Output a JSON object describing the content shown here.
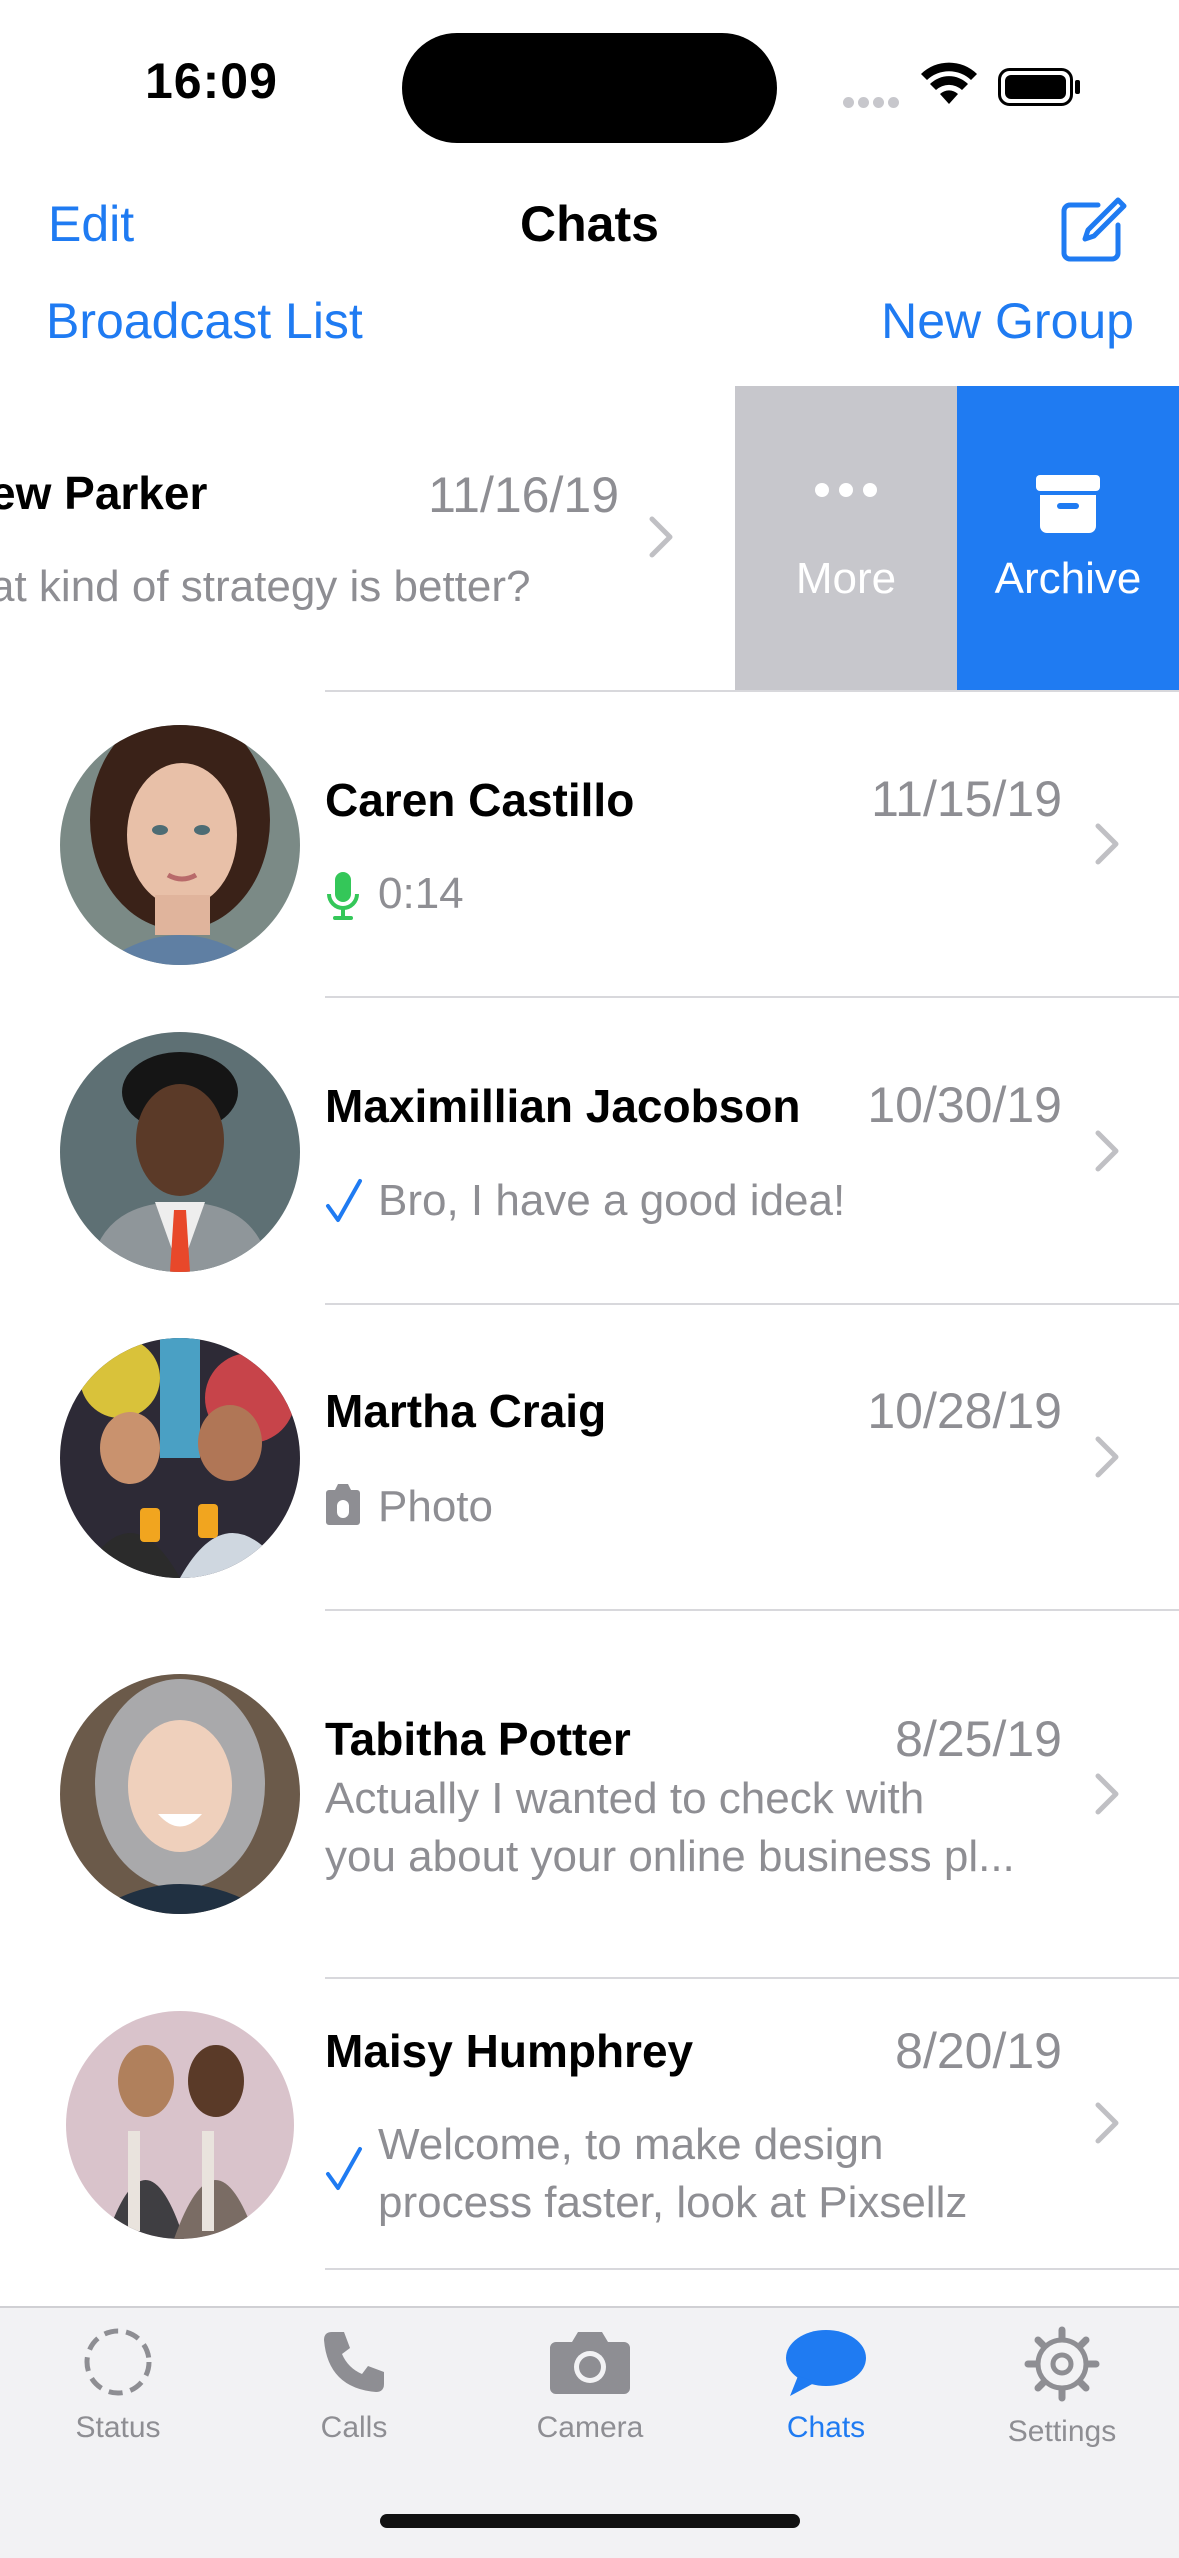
{
  "status_bar": {
    "time": "16:09"
  },
  "nav": {
    "edit": "Edit",
    "title": "Chats",
    "broadcast": "Broadcast List",
    "new_group": "New Group"
  },
  "swiped_chat": {
    "name": "ew Parker",
    "date": "11/16/19",
    "message": "at kind of strategy is better?",
    "actions": {
      "more": "More",
      "archive": "Archive"
    }
  },
  "chats": [
    {
      "name": "Caren Castillo",
      "date": "11/15/19",
      "message": "0:14",
      "icon": "microphone-icon"
    },
    {
      "name": "Maximillian Jacobson",
      "date": "10/30/19",
      "message": "Bro, I have a good idea!",
      "icon": "checkmark-icon"
    },
    {
      "name": "Martha Craig",
      "date": "10/28/19",
      "message": "Photo",
      "icon": "camera-icon"
    },
    {
      "name": "Tabitha Potter",
      "date": "8/25/19",
      "message_line1": "Actually I wanted to check with",
      "message_line2": "you about your online business pl..."
    },
    {
      "name": "Maisy Humphrey",
      "date": "8/20/19",
      "message_line1": "Welcome, to make design",
      "message_line2": "process faster, look at Pixsellz",
      "icon": "checkmark-icon"
    }
  ],
  "tabs": [
    {
      "label": "Status",
      "icon": "status-icon"
    },
    {
      "label": "Calls",
      "icon": "phone-icon"
    },
    {
      "label": "Camera",
      "icon": "camera-icon"
    },
    {
      "label": "Chats",
      "icon": "chat-bubble-icon",
      "active": true
    },
    {
      "label": "Settings",
      "icon": "gear-icon"
    }
  ],
  "colors": {
    "accent": "#1f7bf2",
    "secondary_text": "#8e8e93",
    "more_action": "#c7c7cc",
    "mic_green": "#34c759"
  }
}
